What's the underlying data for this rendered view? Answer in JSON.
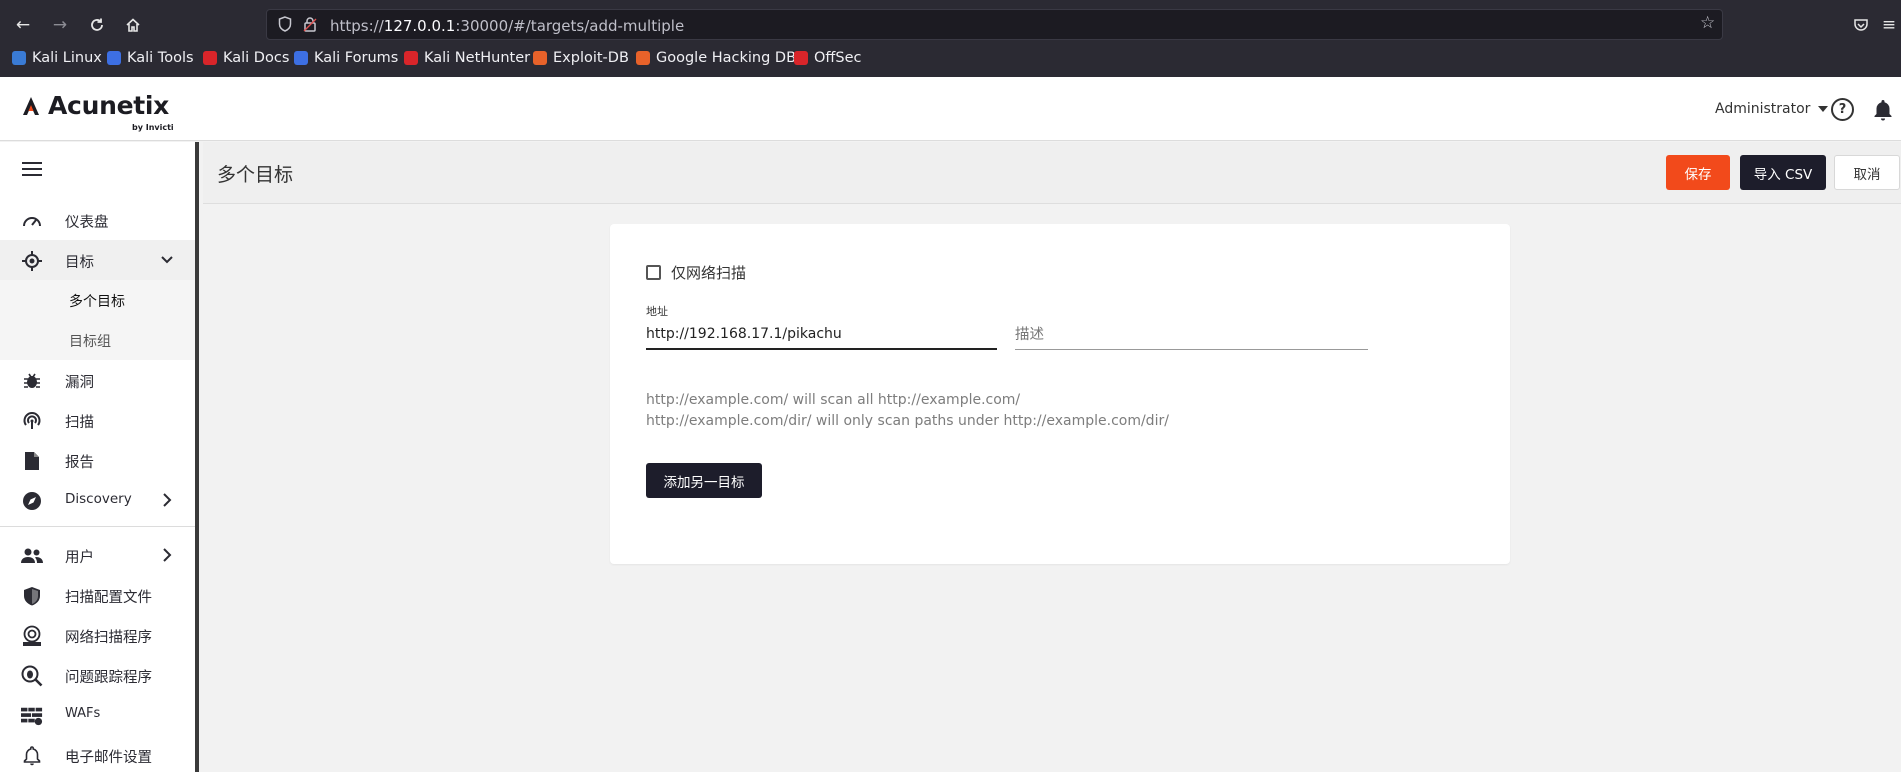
{
  "browser": {
    "url_prefix": "https://",
    "url_host": "127.0.0.1",
    "url_rest": ":30000/#/targets/add-multiple",
    "bookmarks": [
      {
        "label": "Kali Linux",
        "color": "#3a7bd5"
      },
      {
        "label": "Kali Tools",
        "color": "#3d6fe3"
      },
      {
        "label": "Kali Docs",
        "color": "#d9252a"
      },
      {
        "label": "Kali Forums",
        "color": "#3d6fe3"
      },
      {
        "label": "Kali NetHunter",
        "color": "#d9252a"
      },
      {
        "label": "Exploit-DB",
        "color": "#e8622a"
      },
      {
        "label": "Google Hacking DB",
        "color": "#e8622a"
      },
      {
        "label": "OffSec",
        "color": "#d9252a"
      }
    ]
  },
  "header": {
    "logo_text": "Acunetix",
    "logo_sub": "by Invicti",
    "user": "Administrator"
  },
  "sidebar": {
    "items": [
      {
        "label": "仪表盘",
        "icon": "dashboard-icon"
      },
      {
        "label": "目标",
        "icon": "target-icon"
      },
      {
        "label": "多个目标"
      },
      {
        "label": "目标组"
      },
      {
        "label": "漏洞",
        "icon": "bug-icon"
      },
      {
        "label": "扫描",
        "icon": "scan-icon"
      },
      {
        "label": "报告",
        "icon": "report-icon"
      },
      {
        "label": "Discovery",
        "icon": "compass-icon"
      },
      {
        "label": "用户",
        "icon": "users-icon"
      },
      {
        "label": "扫描配置文件",
        "icon": "shield-icon"
      },
      {
        "label": "网络扫描程序",
        "icon": "network-scanner-icon"
      },
      {
        "label": "问题跟踪程序",
        "icon": "issue-tracker-icon"
      },
      {
        "label": "WAFs",
        "icon": "waf-icon"
      },
      {
        "label": "电子邮件设置",
        "icon": "bell-icon"
      }
    ]
  },
  "page": {
    "title": "多个目标",
    "save_label": "保存",
    "import_label": "导入 CSV",
    "cancel_label": "取消"
  },
  "form": {
    "network_only_label": "仅网络扫描",
    "address_label": "地址",
    "address_value": "http://192.168.17.1/pikachu",
    "description_placeholder": "描述",
    "help_line1": "http://example.com/ will scan all http://example.com/",
    "help_line2": "http://example.com/dir/ will only scan paths under http://example.com/dir/",
    "add_another_label": "添加另一目标"
  },
  "colors": {
    "accent": "#f24a1b",
    "dark_button": "#1d1d2b"
  }
}
